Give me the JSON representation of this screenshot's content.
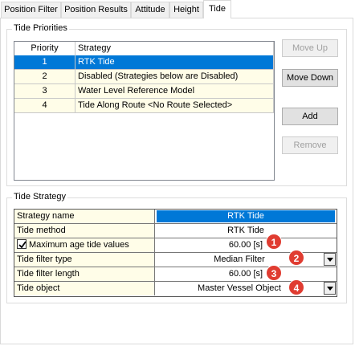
{
  "tabs": [
    {
      "label": "Position Filter",
      "active": false
    },
    {
      "label": "Position Results",
      "active": false
    },
    {
      "label": "Attitude",
      "active": false
    },
    {
      "label": "Height",
      "active": false
    },
    {
      "label": "Tide",
      "active": true
    }
  ],
  "tide_priorities": {
    "title": "Tide Priorities",
    "columns": [
      "Priority",
      "Strategy"
    ],
    "rows": [
      {
        "priority": "1",
        "strategy": "RTK Tide",
        "selected": true
      },
      {
        "priority": "2",
        "strategy": "Disabled (Strategies below are Disabled)",
        "selected": false
      },
      {
        "priority": "3",
        "strategy": "Water Level Reference Model",
        "selected": false
      },
      {
        "priority": "4",
        "strategy": "Tide Along Route <No Route Selected>",
        "selected": false
      }
    ],
    "buttons": {
      "move_up": "Move Up",
      "move_down": "Move Down",
      "add": "Add",
      "remove": "Remove"
    }
  },
  "tide_strategy": {
    "title": "Tide Strategy",
    "rows": [
      {
        "label": "Strategy name",
        "value": "RTK Tide"
      },
      {
        "label": "Tide method",
        "value": "RTK Tide"
      },
      {
        "label": "Maximum age tide values",
        "value": "60.00 [s]",
        "checked": true,
        "marker": "1"
      },
      {
        "label": "Tide filter type",
        "value": "Median Filter",
        "marker": "2"
      },
      {
        "label": "Tide filter length",
        "value": "60.00 [s]",
        "marker": "3"
      },
      {
        "label": "Tide object",
        "value": "Master Vessel Object",
        "marker": "4"
      }
    ]
  },
  "colors": {
    "selection": "#0078d7",
    "row_background": "#fffde8",
    "marker": "#e03c31"
  }
}
